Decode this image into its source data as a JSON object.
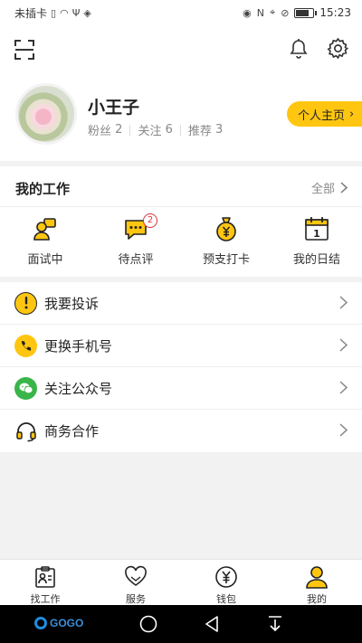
{
  "status_bar": {
    "carrier": "未插卡",
    "time": "15:23"
  },
  "profile": {
    "name": "小王子",
    "fans_label": "粉丝",
    "fans": "2",
    "follow_label": "关注",
    "follow": "6",
    "recommend_label": "推荐",
    "recommend": "3",
    "home_button": "个人主页"
  },
  "work": {
    "title": "我的工作",
    "all_label": "全部",
    "items": [
      {
        "label": "面试中",
        "icon": "interview-icon"
      },
      {
        "label": "待点评",
        "icon": "comment-icon",
        "badge": "2"
      },
      {
        "label": "预支打卡",
        "icon": "money-bag-icon"
      },
      {
        "label": "我的日结",
        "icon": "calendar-icon",
        "day": "1"
      }
    ]
  },
  "menu": [
    {
      "label": "我要投诉",
      "icon": "warning-icon",
      "color": "#ffc611"
    },
    {
      "label": "更换手机号",
      "icon": "phone-icon",
      "color": "#ffc611"
    },
    {
      "label": "关注公众号",
      "icon": "wechat-icon",
      "color": "#39b54a"
    },
    {
      "label": "商务合作",
      "icon": "headset-icon",
      "color": "#333333"
    }
  ],
  "tabs": [
    {
      "label": "找工作",
      "icon": "job-icon"
    },
    {
      "label": "服务",
      "icon": "heart-icon"
    },
    {
      "label": "钱包",
      "icon": "wallet-icon"
    },
    {
      "label": "我的",
      "icon": "person-icon"
    }
  ],
  "navbar": {
    "logo_text": "GOGO"
  },
  "colors": {
    "accent": "#ffc611",
    "badge": "#d9333f"
  }
}
